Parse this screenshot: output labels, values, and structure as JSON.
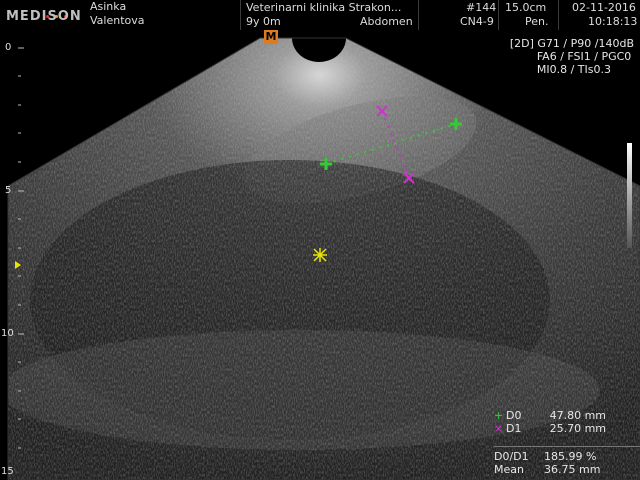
{
  "header": {
    "logo": "MEDISON",
    "patient_first": "Asinka",
    "patient_last": "Valentova",
    "clinic": "Veterinarni klinika Strakon...",
    "age": "9y 0m",
    "exam": "Abdomen",
    "image_no": "#144",
    "probe": "CN4-9",
    "depth": "15.0cm",
    "preset": "Pen.",
    "date": "02-11-2016",
    "time": "10:18:13"
  },
  "orientation_marker": "M",
  "scan_params": {
    "line1": "[2D] G71 / P90 /140dB",
    "line2": "FA6 / FSI1 / PGC0",
    "line3": "MI0.8 / TIs0.3"
  },
  "depth_scale": {
    "labels": [
      "0",
      "5",
      "10",
      "15"
    ],
    "values_cm": [
      0,
      5,
      10,
      15
    ]
  },
  "measurements": {
    "items": [
      {
        "symbol": "+",
        "label": "D0",
        "value": "47.80 mm",
        "color": "#33cc33"
      },
      {
        "symbol": "×",
        "label": "D1",
        "value": "25.70 mm",
        "color": "#cc33cc"
      }
    ],
    "ratio_label": "D0/D1",
    "ratio_value": "185.99 %",
    "mean_label": "Mean",
    "mean_value": "36.75 mm"
  },
  "colors": {
    "caliper_d0": "#33cc33",
    "caliper_d1": "#cc33cc",
    "focus_marker": "#e6e600",
    "orientation_marker": "#e07a1f"
  }
}
